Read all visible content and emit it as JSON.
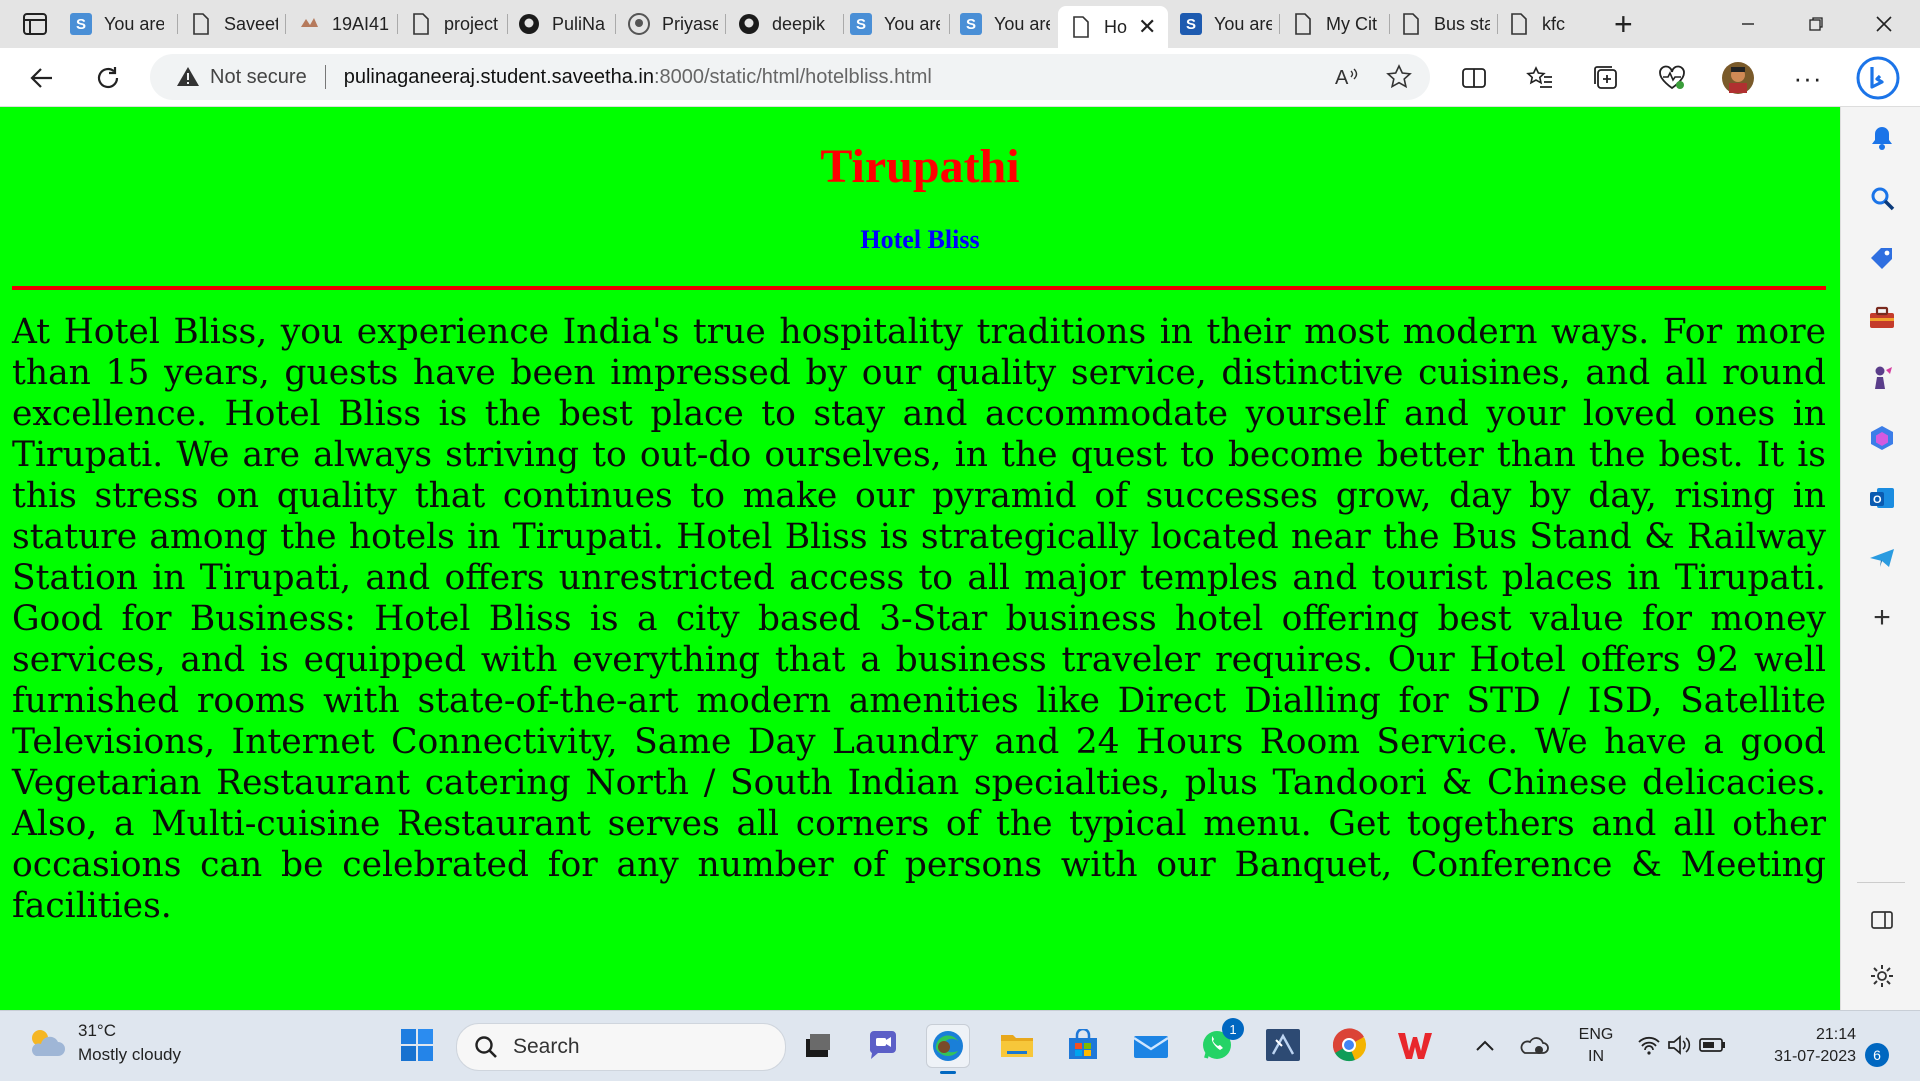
{
  "tabs": [
    {
      "title": "You are",
      "icon": "s-icon",
      "active": false
    },
    {
      "title": "Saveetha",
      "icon": "page-icon",
      "active": false
    },
    {
      "title": "19AI41",
      "icon": "hand-icon",
      "active": false
    },
    {
      "title": "project",
      "icon": "page-icon",
      "active": false
    },
    {
      "title": "PuliNa",
      "icon": "github-icon",
      "active": false
    },
    {
      "title": "Priyase",
      "icon": "github-icon",
      "active": false
    },
    {
      "title": "deepik",
      "icon": "github-icon",
      "active": false
    },
    {
      "title": "You are",
      "icon": "s-icon",
      "active": false
    },
    {
      "title": "You are",
      "icon": "s-icon",
      "active": false
    },
    {
      "title": "Ho",
      "icon": "page-icon",
      "active": true
    },
    {
      "title": "You are",
      "icon": "s-icon",
      "active": false
    },
    {
      "title": "My Cit",
      "icon": "page-icon",
      "active": false
    },
    {
      "title": "Bus sta",
      "icon": "page-icon",
      "active": false
    },
    {
      "title": "kfc",
      "icon": "page-icon",
      "active": false
    }
  ],
  "address": {
    "security": "Not secure",
    "host": "pulinaganeeraj.student.saveetha.in",
    "path": ":8000/static/html/hotelbliss.html"
  },
  "page": {
    "title": "Tirupathi",
    "subtitle": "Hotel Bliss",
    "body": "At Hotel Bliss, you experience India's true hospitality traditions in their most modern ways. For more than 15 years, guests have been impressed by our quality service, distinctive cuisines, and all round excellence. Hotel Bliss is the best place to stay and accommodate yourself and your loved ones in Tirupati. We are always striving to out-do ourselves, in the quest to become better than the best. It is this stress on quality that continues to make our pyramid of successes grow, day by day, rising in stature among the hotels in Tirupati. Hotel Bliss is strategically located near the Bus Stand & Railway Station in Tirupati, and offers unrestricted access to all major temples and tourist places in Tirupati. Good for Business: Hotel Bliss is a city based 3-Star business hotel offering best value for money services, and is equipped with everything that a business traveler requires. Our Hotel offers 92 well furnished rooms with state-of-the-art modern amenities like Direct Dialling for STD / ISD, Satellite Televisions, Internet Connectivity, Same Day Laundry and 24 Hours Room Service. We have a good Vegetarian Restaurant catering North / South Indian specialties, plus Tandoori & Chinese delicacies. Also, a Multi-cuisine Restaurant serves all corners of the typical menu. Get togethers and all other occasions can be celebrated for any number of persons with our Banquet, Conference & Meeting facilities.",
    "colors": {
      "background": "#00ff00",
      "title": "#ff0000",
      "subtitle": "#0000ff",
      "rule": "#ee0000"
    }
  },
  "taskbar": {
    "weather_temp": "31°C",
    "weather_desc": "Mostly cloudy",
    "search_placeholder": "Search",
    "whatsapp_badge": "1",
    "lang_top": "ENG",
    "lang_bottom": "IN",
    "time": "21:14",
    "date": "31-07-2023",
    "notification_count": "6"
  }
}
